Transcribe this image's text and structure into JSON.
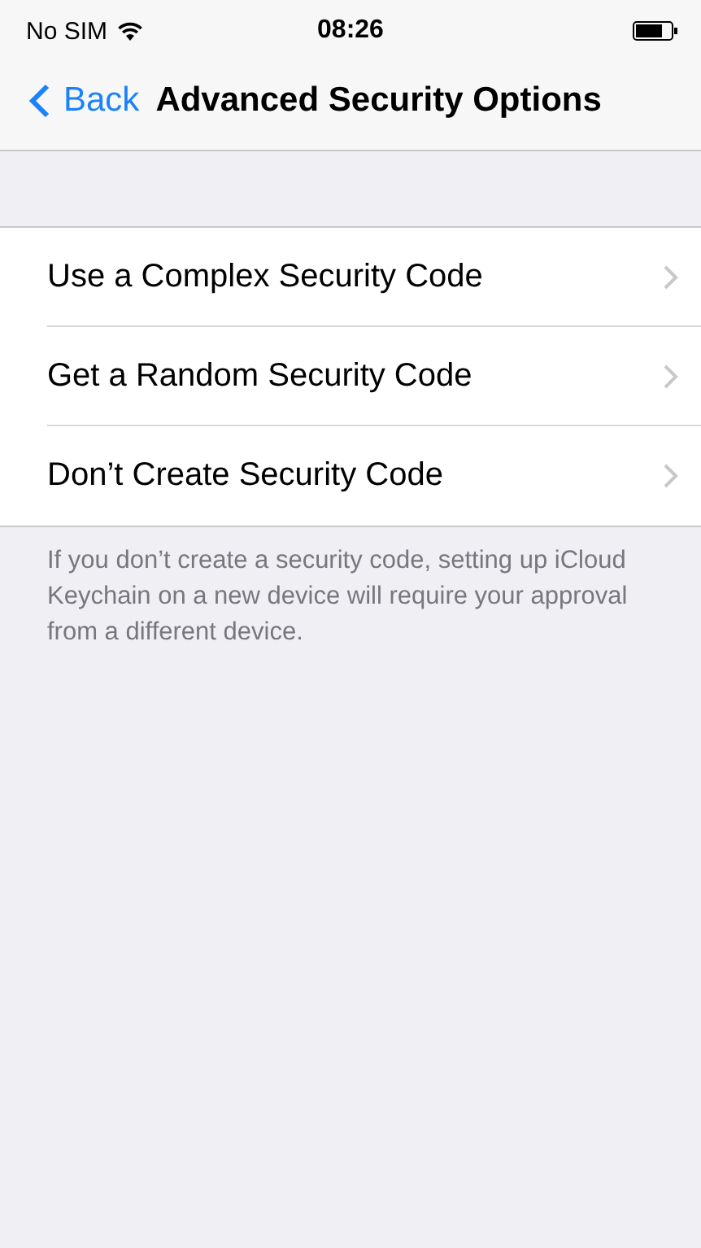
{
  "status_bar": {
    "carrier": "No SIM",
    "time": "08:26"
  },
  "nav_bar": {
    "back": "Back",
    "title": "Advanced Security Options"
  },
  "options": [
    {
      "label": "Use a Complex Security Code"
    },
    {
      "label": "Get a Random Security Code"
    },
    {
      "label": "Don’t Create Security Code"
    }
  ],
  "footer": "If you don’t create a security code, setting up iCloud Keychain on a new device will require your approval from a different device."
}
